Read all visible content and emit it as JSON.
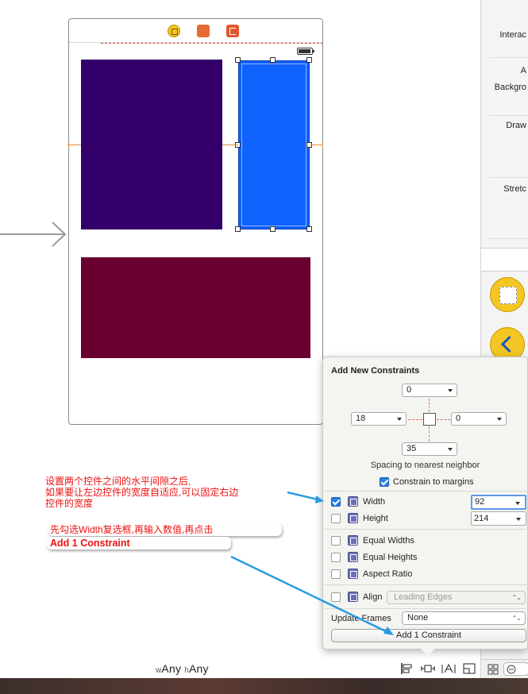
{
  "canvas": {
    "size_class": {
      "w_prefix": "w",
      "w_value": "Any",
      "h_prefix": "h",
      "h_value": "Any"
    }
  },
  "utilities": {
    "labels": [
      "Interac",
      "A",
      "Backgro",
      "Draw",
      "Stretc"
    ]
  },
  "popover": {
    "title": "Add New Constraints",
    "pins": {
      "top": "0",
      "left": "18",
      "right": "0",
      "bottom": "35"
    },
    "spacing_label": "Spacing to nearest neighbor",
    "constrain_margins": {
      "label": "Constrain to margins",
      "checked": true
    },
    "width": {
      "label": "Width",
      "checked": true,
      "value": "92"
    },
    "height": {
      "label": "Height",
      "checked": false,
      "value": "214"
    },
    "equal_widths": {
      "label": "Equal Widths",
      "checked": false
    },
    "equal_heights": {
      "label": "Equal Heights",
      "checked": false
    },
    "aspect_ratio": {
      "label": "Aspect Ratio",
      "checked": false
    },
    "align": {
      "label": "Align",
      "checked": false,
      "value": "Leading Edges"
    },
    "update_frames": {
      "label": "Update Frames",
      "value": "None"
    },
    "add_button": "Add 1 Constraint"
  },
  "annotations": {
    "note1_line1": "设置两个控件之间的水平间隙之后,",
    "note1_line2": "如果要让左边控件的宽度自适应,可以固定右边",
    "note1_line3": "控件的宽度",
    "note2": "先勾选Width复选框,再输入数值,再点击",
    "note3": "Add 1 Constraint"
  },
  "colors": {
    "purple_view": "#33006b",
    "blue_view": "#0f62fe",
    "maroon_view": "#6a0030",
    "annotation_text": "#ee1111",
    "annotation_arrow": "#2a9be0"
  }
}
